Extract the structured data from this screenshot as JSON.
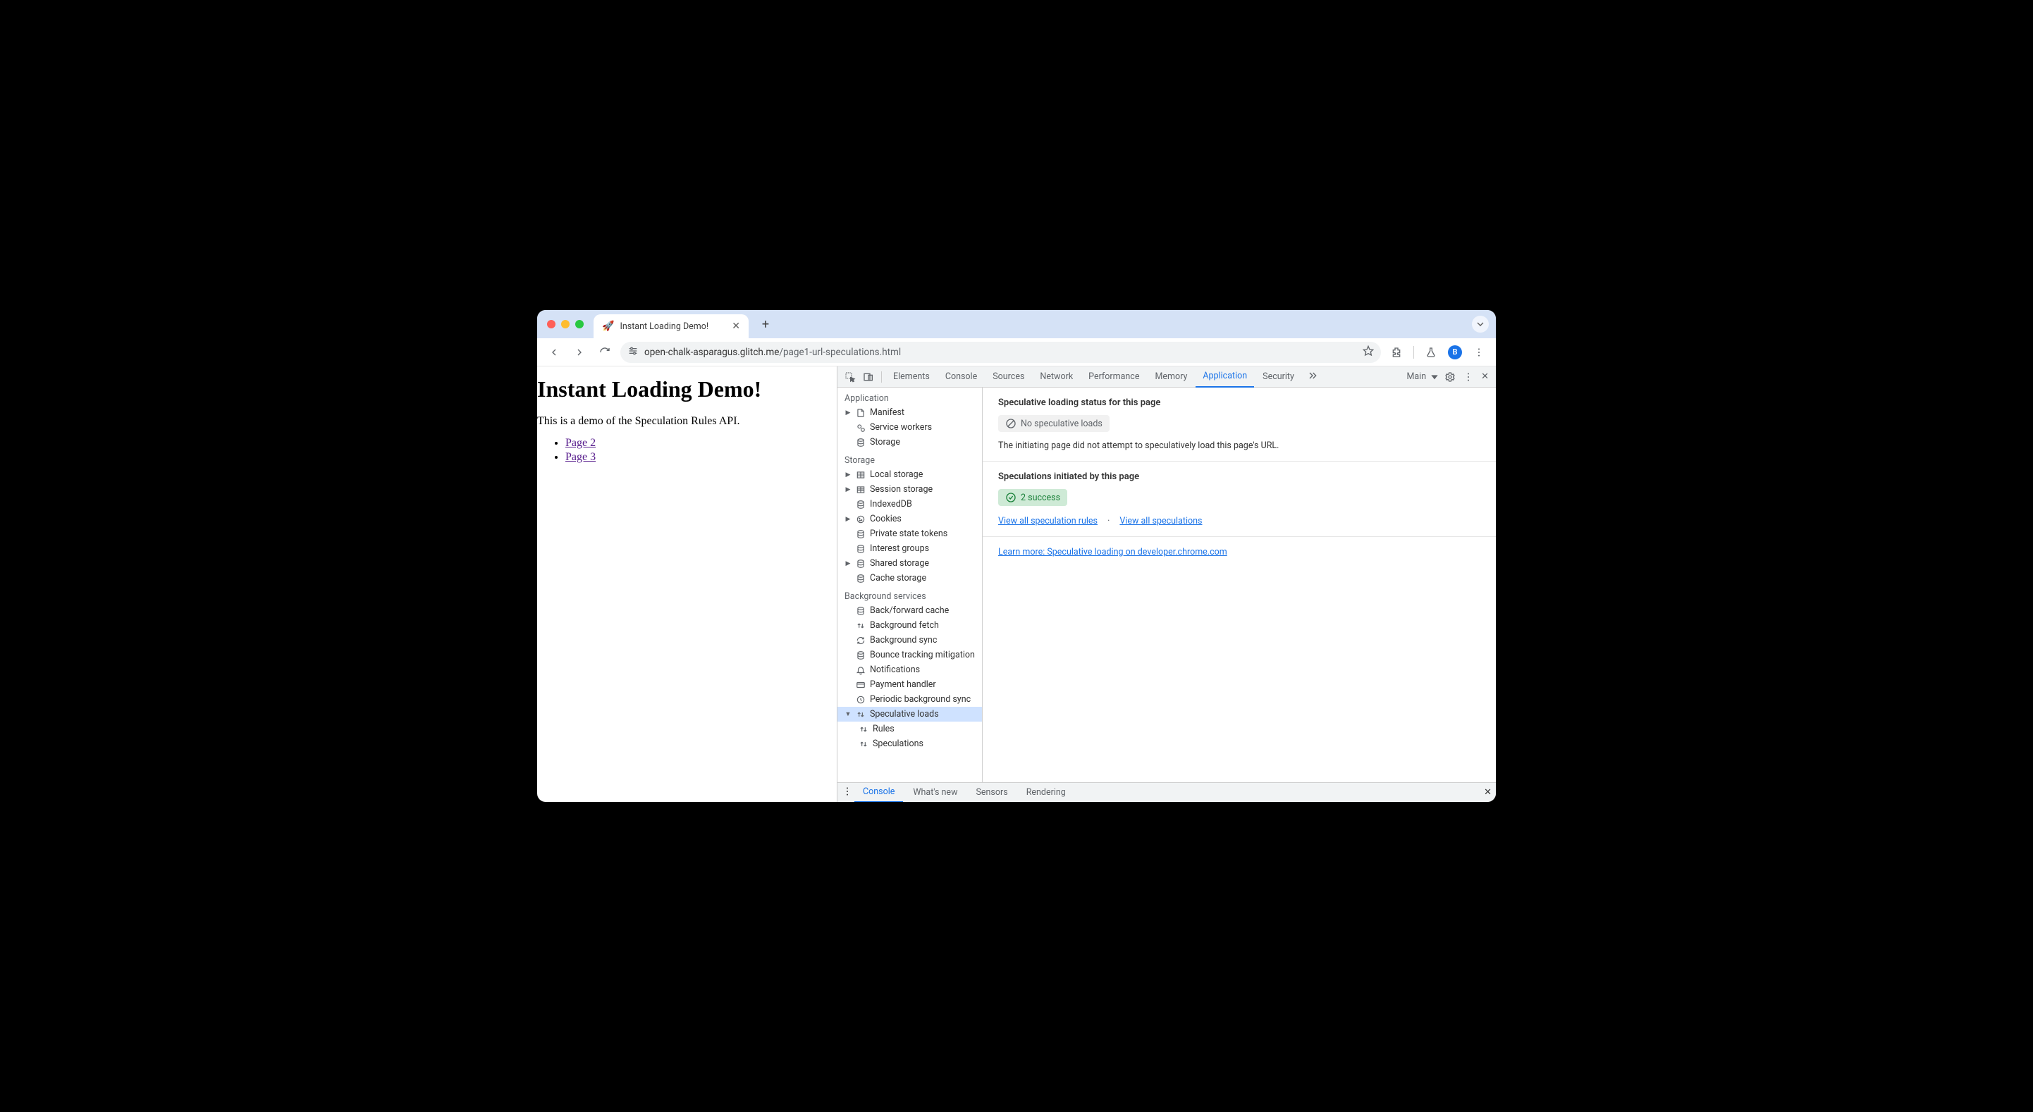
{
  "browser": {
    "tab_favicon": "🚀",
    "tab_title": "Instant Loading Demo!",
    "url_host": "open-chalk-asparagus.glitch.me",
    "url_path": "/page1-url-speculations.html",
    "avatar_initial": "B"
  },
  "page": {
    "heading": "Instant Loading Demo!",
    "intro": "This is a demo of the Speculation Rules API.",
    "links": [
      "Page 2",
      "Page 3"
    ]
  },
  "devtools": {
    "tabs": [
      "Elements",
      "Console",
      "Sources",
      "Network",
      "Performance",
      "Memory",
      "Application",
      "Security"
    ],
    "active_tab": "Application",
    "target_label": "Main",
    "sidebar": {
      "sections": [
        {
          "title": "Application",
          "items": [
            {
              "label": "Manifest",
              "icon": "file",
              "expandable": true
            },
            {
              "label": "Service workers",
              "icon": "gear"
            },
            {
              "label": "Storage",
              "icon": "db"
            }
          ]
        },
        {
          "title": "Storage",
          "items": [
            {
              "label": "Local storage",
              "icon": "table",
              "expandable": true
            },
            {
              "label": "Session storage",
              "icon": "table",
              "expandable": true
            },
            {
              "label": "IndexedDB",
              "icon": "db"
            },
            {
              "label": "Cookies",
              "icon": "cookie",
              "expandable": true
            },
            {
              "label": "Private state tokens",
              "icon": "db"
            },
            {
              "label": "Interest groups",
              "icon": "db"
            },
            {
              "label": "Shared storage",
              "icon": "db",
              "expandable": true
            },
            {
              "label": "Cache storage",
              "icon": "db"
            }
          ]
        },
        {
          "title": "Background services",
          "items": [
            {
              "label": "Back/forward cache",
              "icon": "db"
            },
            {
              "label": "Background fetch",
              "icon": "updown"
            },
            {
              "label": "Background sync",
              "icon": "sync"
            },
            {
              "label": "Bounce tracking mitigation",
              "icon": "db"
            },
            {
              "label": "Notifications",
              "icon": "bell"
            },
            {
              "label": "Payment handler",
              "icon": "card"
            },
            {
              "label": "Periodic background sync",
              "icon": "clock"
            },
            {
              "label": "Speculative loads",
              "icon": "updown",
              "selected": true,
              "expanded": true,
              "children": [
                {
                  "label": "Rules",
                  "icon": "updown"
                },
                {
                  "label": "Speculations",
                  "icon": "updown"
                }
              ]
            }
          ]
        }
      ]
    },
    "main": {
      "status_heading": "Speculative loading status for this page",
      "status_badge": "No speculative loads",
      "status_text": "The initiating page did not attempt to speculatively load this page's URL.",
      "init_heading": "Speculations initiated by this page",
      "init_badge": "2 success",
      "link_rules": "View all speculation rules",
      "link_specs": "View all speculations",
      "learn_more": "Learn more: Speculative loading on developer.chrome.com"
    },
    "drawer": {
      "tabs": [
        "Console",
        "What's new",
        "Sensors",
        "Rendering"
      ],
      "active": "Console"
    }
  }
}
